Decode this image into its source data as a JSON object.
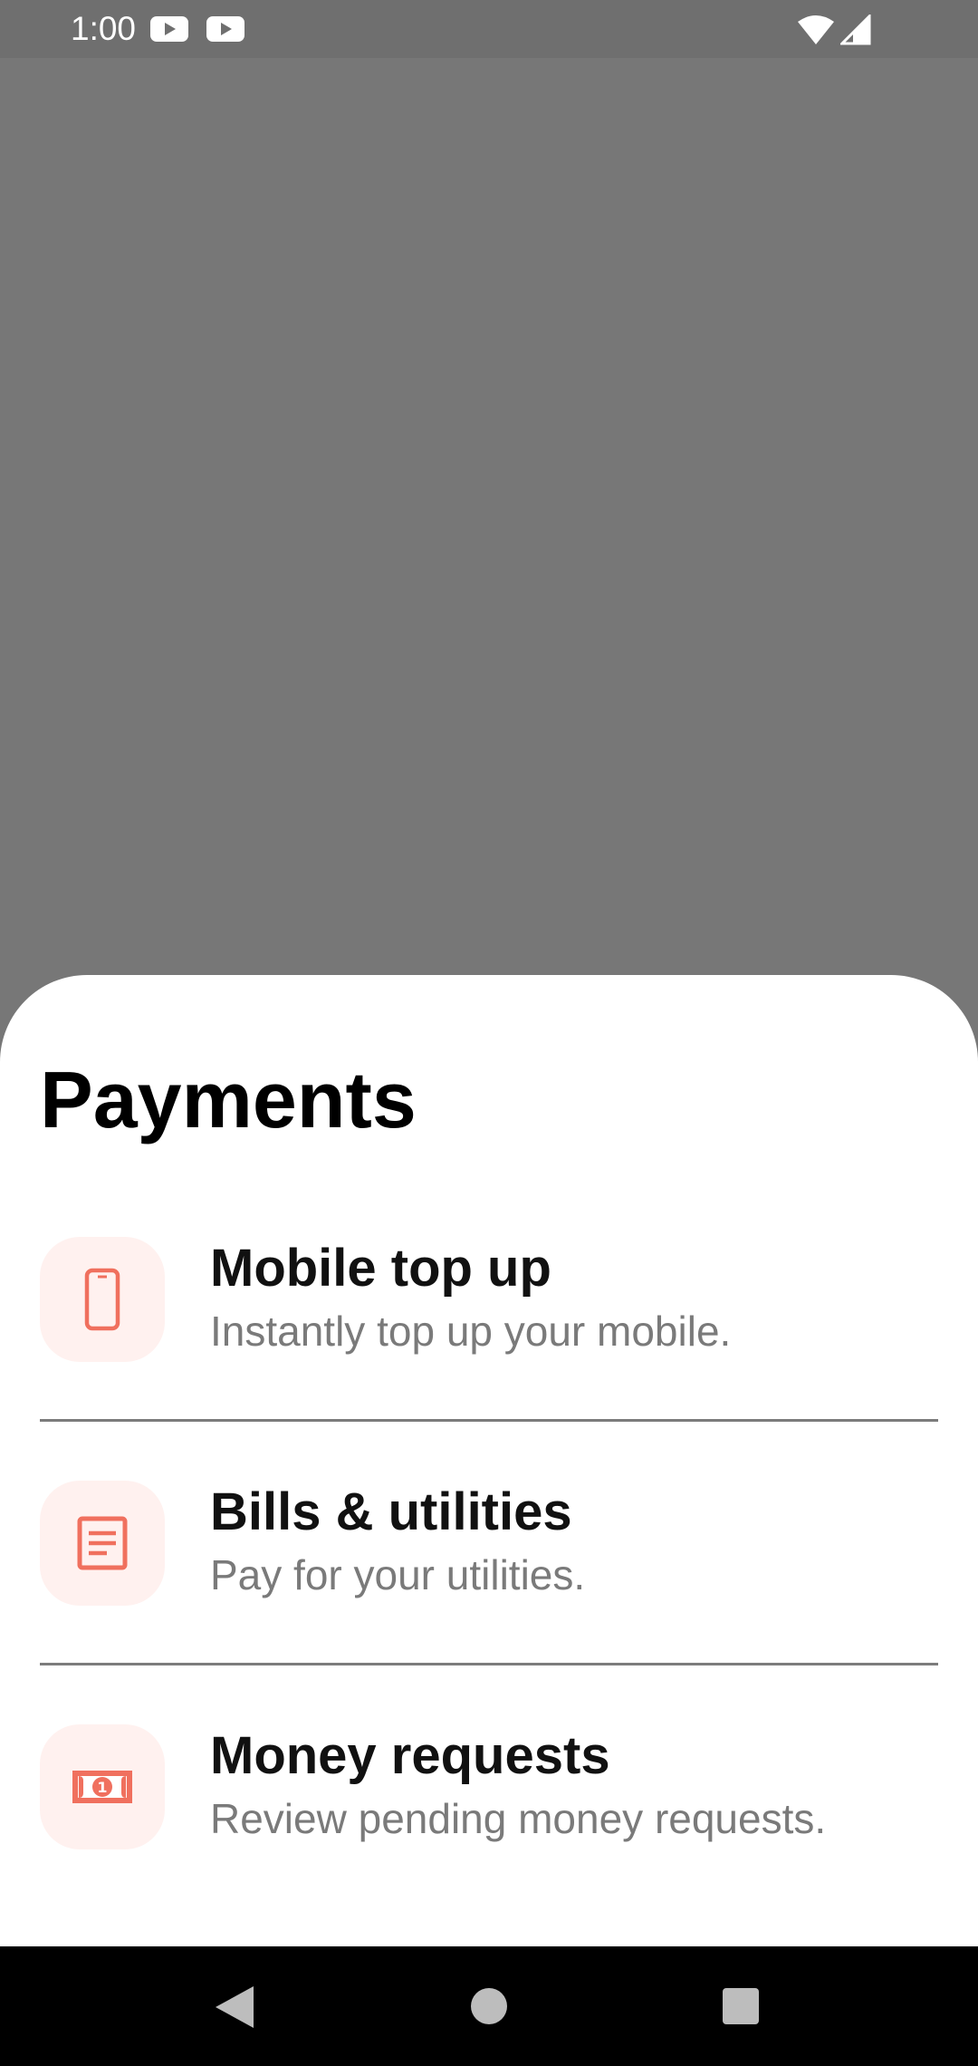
{
  "status_bar": {
    "time": "1:00",
    "notification_icons": [
      "youtube-icon",
      "youtube-icon"
    ],
    "system_icons": [
      "wifi-icon",
      "cellular-signal-icon"
    ]
  },
  "sheet": {
    "title": "Payments",
    "accent_color": "#F0705E",
    "icon_bg_color": "#FFF1EF",
    "options": [
      {
        "icon": "smartphone-icon",
        "title": "Mobile top up",
        "subtitle": "Instantly top up your mobile."
      },
      {
        "icon": "receipt-icon",
        "title": "Bills & utilities",
        "subtitle": "Pay for your utilities."
      },
      {
        "icon": "banknote-icon",
        "title": "Money requests",
        "subtitle": "Review pending money requests."
      }
    ]
  },
  "nav_bar": {
    "buttons": [
      "back-icon",
      "home-icon",
      "recents-icon"
    ]
  }
}
